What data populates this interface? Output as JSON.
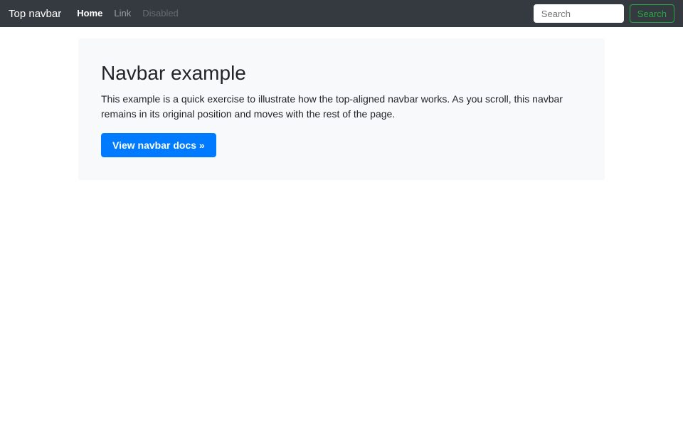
{
  "navbar": {
    "brand": "Top navbar",
    "links": [
      {
        "label": "Home",
        "state": "active"
      },
      {
        "label": "Link",
        "state": "normal"
      },
      {
        "label": "Disabled",
        "state": "disabled"
      }
    ],
    "search": {
      "placeholder": "Search",
      "button_label": "Search"
    }
  },
  "jumbotron": {
    "title": "Navbar example",
    "description": "This example is a quick exercise to illustrate how the top-aligned navbar works. As you scroll, this navbar remains in its original position and moves with the rest of the page.",
    "cta_label": "View navbar docs »"
  },
  "colors": {
    "navbar_background": "#343a40",
    "jumbotron_background": "#f8f9fa",
    "primary_button": "#007bff",
    "success_outline": "#28a745",
    "body_text": "#212529"
  }
}
